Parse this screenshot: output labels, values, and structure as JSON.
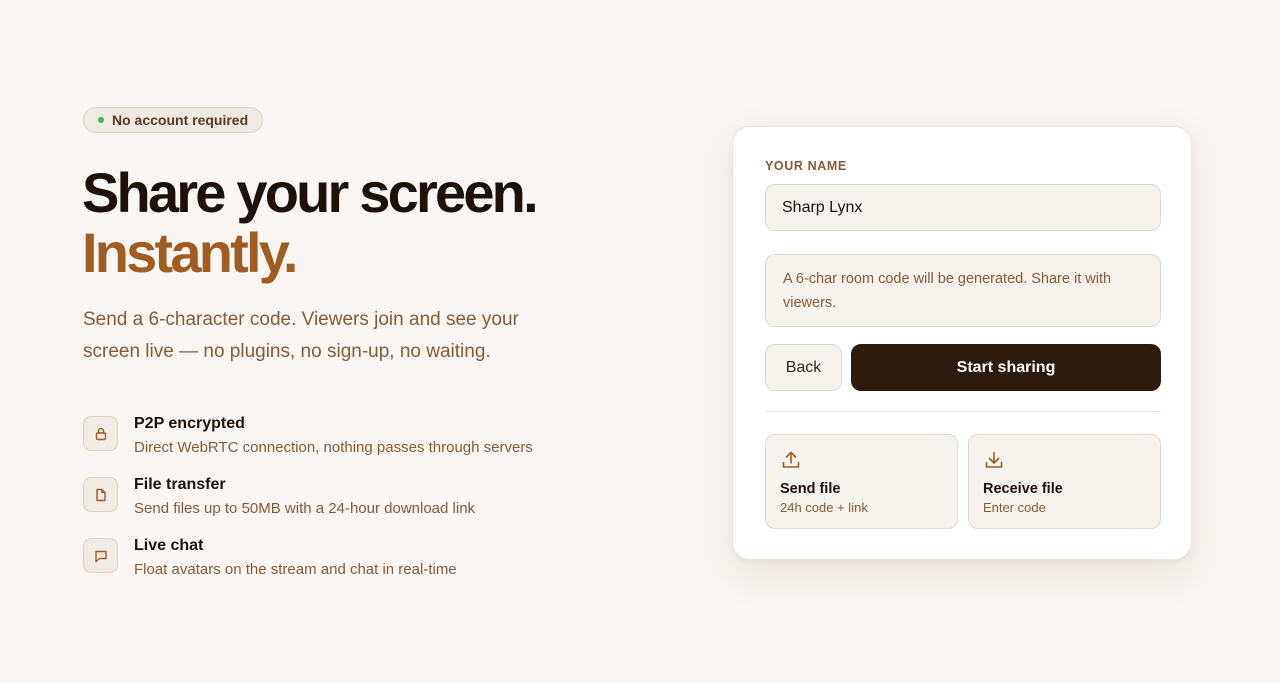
{
  "badge": {
    "text": "No account required",
    "dot_color": "#3db869"
  },
  "hero": {
    "headline_line1": "Share your screen.",
    "headline_line2": "Instantly.",
    "accent_color": "#a15c22",
    "lede": "Send a 6-character code. Viewers join and see your screen live — no plugins, no sign-up, no waiting."
  },
  "features": [
    {
      "icon": "lock-icon",
      "title": "P2P encrypted",
      "desc": "Direct WebRTC connection, nothing passes through servers"
    },
    {
      "icon": "file-icon",
      "title": "File transfer",
      "desc": "Send files up to 50MB with a 24-hour download link"
    },
    {
      "icon": "chat-icon",
      "title": "Live chat",
      "desc": "Float avatars on the stream and chat in real-time"
    }
  ],
  "card": {
    "name_label": "YOUR NAME",
    "name_value": "Sharp Lynx",
    "info_text": "A 6-char room code will be generated. Share it with viewers.",
    "back_label": "Back",
    "start_label": "Start sharing",
    "primary_color": "#2d1b0e",
    "send_tile": {
      "icon": "upload-icon",
      "title": "Send file",
      "subtitle": "24h code + link"
    },
    "receive_tile": {
      "icon": "download-icon",
      "title": "Receive file",
      "subtitle": "Enter code"
    }
  }
}
